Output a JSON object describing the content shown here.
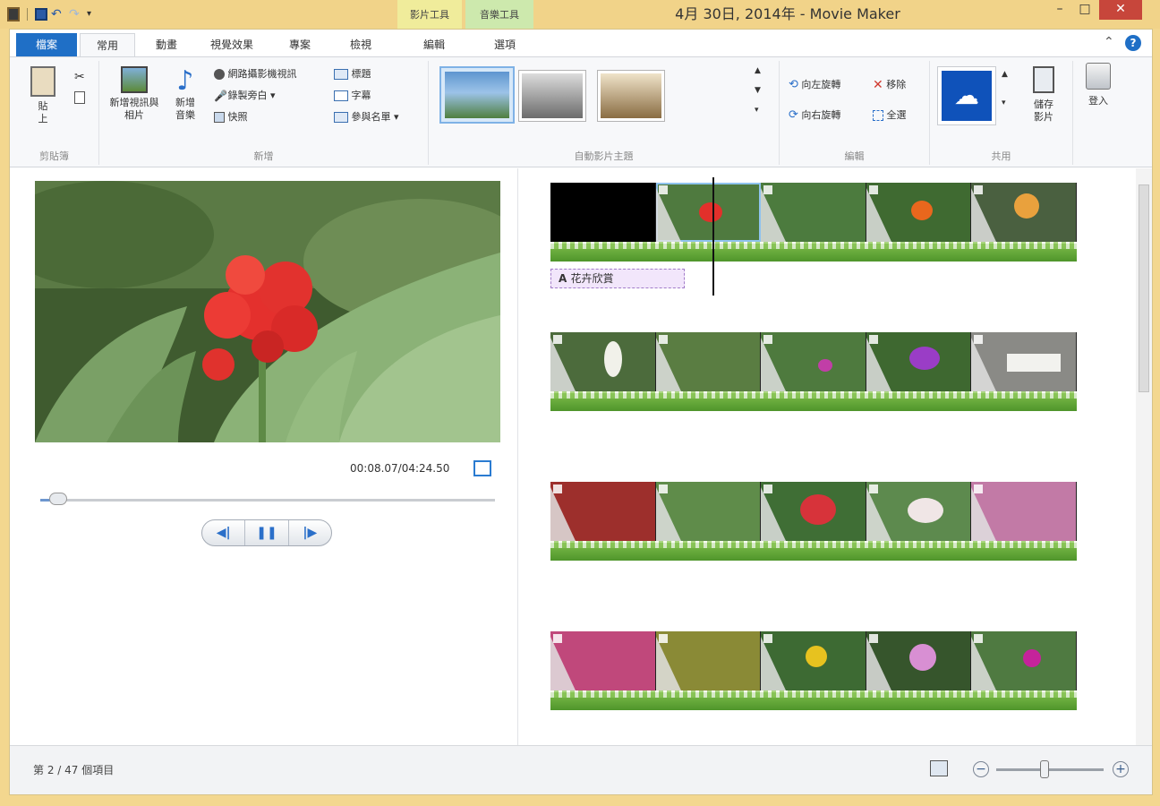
{
  "window": {
    "title": "4月 30日, 2014年 - Movie Maker",
    "context_tabs": {
      "video_tools": "影片工具",
      "audio_tools": "音樂工具"
    },
    "controls": {
      "minimize": "–",
      "maximize": "□",
      "close": "✕"
    }
  },
  "ribbon": {
    "tabs": {
      "file": "檔案",
      "home": "常用",
      "animations": "動畫",
      "visual_effects": "視覺效果",
      "project": "專案",
      "view": "檢視",
      "edit": "編輯",
      "options": "選項"
    },
    "help": "?",
    "clipboard": {
      "paste": "貼上",
      "label": "剪貼簿"
    },
    "add": {
      "add_videos": "新增視訊與相片",
      "add_music": "新增音樂",
      "webcam": "網路攝影機視訊",
      "narration": "錄製旁白",
      "snapshot": "快照",
      "title": "標題",
      "caption": "字幕",
      "credits": "參與名單",
      "label": "新增"
    },
    "themes": {
      "label": "自動影片主題"
    },
    "editing": {
      "rotate_left": "向左旋轉",
      "rotate_right": "向右旋轉",
      "remove": "移除",
      "select_all": "全選",
      "label": "編輯"
    },
    "share": {
      "save_movie": "儲存影片",
      "label": "共用"
    },
    "sign_in": "登入"
  },
  "preview": {
    "timecode": "00:08.07/04:24.50",
    "progress_fraction": 0.03
  },
  "storyboard": {
    "caption_text": "花卉欣賞"
  },
  "status": {
    "items_text": "第 2 / 47 個項目"
  },
  "zoom": {
    "minus": "−",
    "plus": "+",
    "level_fraction": 0.45
  }
}
